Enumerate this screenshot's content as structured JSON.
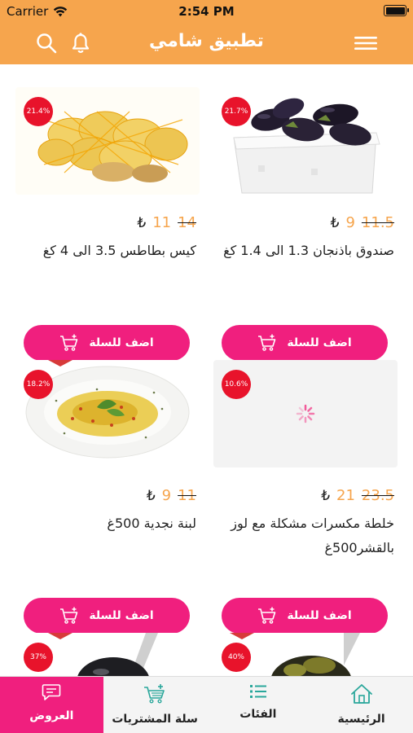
{
  "status_bar": {
    "carrier": "Carrier",
    "time": "2:54 PM"
  },
  "header": {
    "title": "تطبيق شامي",
    "menu_icon": "hamburger-menu-icon",
    "search_icon": "search-icon",
    "bell_icon": "bell-icon"
  },
  "colors": {
    "accent": "#f6a54d",
    "pink": "#f01f7e",
    "badge": "#e8132b"
  },
  "currency": "₺",
  "products": [
    {
      "discount": "21.4%",
      "old_price": "14",
      "new_price": "11",
      "name": "كيس بطاطس 3.5 الى 4 كغ",
      "button": "اضف للسلة",
      "image": "potatoes"
    },
    {
      "discount": "21.7%",
      "old_price": "11.5",
      "new_price": "9",
      "name": "صندوق باذنجان 1.3 الى 1.4 كغ",
      "button": "اضف للسلة",
      "image": "eggplants"
    },
    {
      "discount": "18.2%",
      "old_price": "11",
      "new_price": "9",
      "name": "لبنة نجدية 500غ",
      "button": "اضف للسلة",
      "image": "labneh"
    },
    {
      "discount": "10.6%",
      "old_price": "23.5",
      "new_price": "21",
      "name": "خلطة مكسرات مشكلة مع لوز بالقشر500غ",
      "button": "اضف للسلة",
      "image": "loading-placeholder"
    },
    {
      "discount": "37%",
      "image": "olives-black"
    },
    {
      "discount": "40%",
      "image": "olives-green"
    }
  ],
  "tabs": [
    {
      "label": "العروض",
      "icon": "chat-icon",
      "active": true
    },
    {
      "label": "سلة المشتريات",
      "icon": "cart-icon",
      "active": false
    },
    {
      "label": "الفئات",
      "icon": "list-icon",
      "active": false
    },
    {
      "label": "الرئيسية",
      "icon": "home-icon",
      "active": false
    }
  ]
}
